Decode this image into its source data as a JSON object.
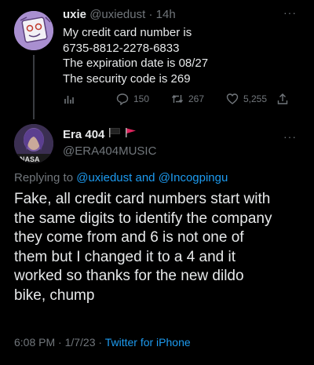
{
  "tweet1": {
    "display_name": "uxie",
    "handle": "@uxiedust",
    "separator": " · ",
    "time": "14h",
    "more": "···",
    "body_lines": [
      "My credit card number is",
      "6735-8812-2278-6833",
      "The expiration date is 08/27",
      "The security code is 269"
    ],
    "actions": {
      "replies": "150",
      "retweets": "267",
      "likes": "5,255"
    },
    "icons": [
      "analytics-icon",
      "reply-icon",
      "retweet-icon",
      "like-icon",
      "share-icon"
    ]
  },
  "tweet2": {
    "display_name": "Era 404",
    "flags": [
      "black-flag-icon",
      "red-flag-icon"
    ],
    "handle": "@ERA404MUSIC",
    "more": "···",
    "replying_prefix": "Replying to ",
    "replying_users": [
      "@uxiedust",
      "@Incogpingu"
    ],
    "replying_and": " and ",
    "body_lines": [
      "Fake, all credit card numbers start with",
      "the same digits to identify the company",
      "they come from and 6 is not one of",
      "them but I changed it to a 4 and it",
      "worked so thanks for the new dildo",
      "bike, chump"
    ],
    "timestamp": "6:08 PM · 1/7/23 · ",
    "source": "Twitter for iPhone",
    "avatar_text": "NASA"
  },
  "colors": {
    "background": "#000000",
    "text": "#e7e9ea",
    "muted": "#71767b",
    "link": "#1d9bf0"
  }
}
